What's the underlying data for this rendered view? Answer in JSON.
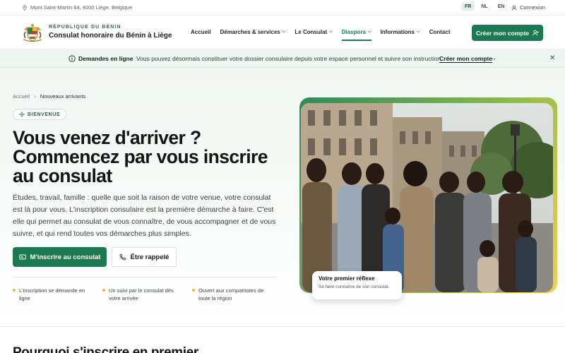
{
  "topbar": {
    "address": "Mont Saint-Martin 84, 4000 Liège, Belgique",
    "languages": [
      "FR",
      "NL",
      "EN"
    ],
    "active_language": "FR",
    "login_label": "Connexion"
  },
  "header": {
    "brand_top": "RÉPUBLIQUE DU BÉNIN",
    "brand_name": "Consulat honoraire du Bénin à Liège",
    "nav": [
      {
        "label": "Accueil",
        "dropdown": false
      },
      {
        "label": "Démarches & services",
        "dropdown": true
      },
      {
        "label": "Le Consulat",
        "dropdown": true
      },
      {
        "label": "Diaspora",
        "dropdown": true,
        "active": true
      },
      {
        "label": "Informations",
        "dropdown": true
      },
      {
        "label": "Contact",
        "dropdown": false
      }
    ],
    "cta_label": "Créer mon compte"
  },
  "announcement": {
    "title": "Demandes en ligne",
    "text": "Vous pouvez désormais constituer votre dossier consulaire depuis votre espace personnel et suivre son instruction.",
    "link": "Créer mon compte"
  },
  "hero": {
    "breadcrumb": [
      "Accueil",
      "Nouveaux arrivants"
    ],
    "badge": "BIENVENUE",
    "title": "Vous venez d'arriver ? Commencez par vous inscrire au consulat",
    "text": "Études, travail, famille : quelle que soit la raison de votre venue, votre consulat est là pour vous. L'inscription consulaire est la première démarche à faire. C'est elle qui permet au consulat de vous connaître, de vous accompagner et de vous suivre, et qui rend toutes vos démarches plus simples.",
    "primary_button": "M'inscrire au consulat",
    "secondary_button": "Être rappelé",
    "features": [
      "L'inscription se demande en ligne",
      "Un suivi par le consulat dès votre arrivée",
      "Ouvert aux compatriotes de toute la région"
    ],
    "image_card": {
      "title": "Votre premier réflexe",
      "subtitle": "Se faire connaître de son consulat."
    }
  },
  "next_section": {
    "title": "Pourquoi s'inscrire en premier"
  },
  "colors": {
    "primary": "#1c7a52",
    "accent": "#f2b632"
  }
}
